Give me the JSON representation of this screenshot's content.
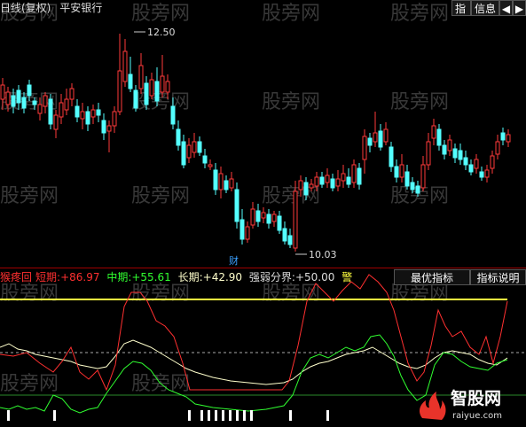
{
  "header": {
    "title": "日线(复权)",
    "stock_name": "平安银行",
    "btn_index": "指",
    "btn_info": "信息",
    "nav_back": "◀",
    "nav_fwd": "▶"
  },
  "watermark": "股旁网",
  "price_chart": {
    "max_label": "12.50",
    "min_label": "10.03",
    "marker": "财",
    "colors": {
      "up": "#ff3a3a",
      "down": "#54ffff",
      "marker": "#3aa0ff"
    }
  },
  "indicator": {
    "name": "猴疼回",
    "short_label": "短期:",
    "short_value": "+86.97",
    "mid_label": "中期:",
    "mid_value": "+55.61",
    "long_label": "长期:",
    "long_value": "+42.90",
    "thresh_label": "强弱分界:",
    "thresh_value": "+50.00",
    "alert": "警",
    "btn_best": "最优指标",
    "btn_explain": "指标说明",
    "colors": {
      "short": "#ff3030",
      "mid": "#30ff30",
      "long": "#ffffcc",
      "thresh": "#ffff40"
    }
  },
  "logo": {
    "brand": "智股网",
    "url": "raiyue.com"
  }
}
